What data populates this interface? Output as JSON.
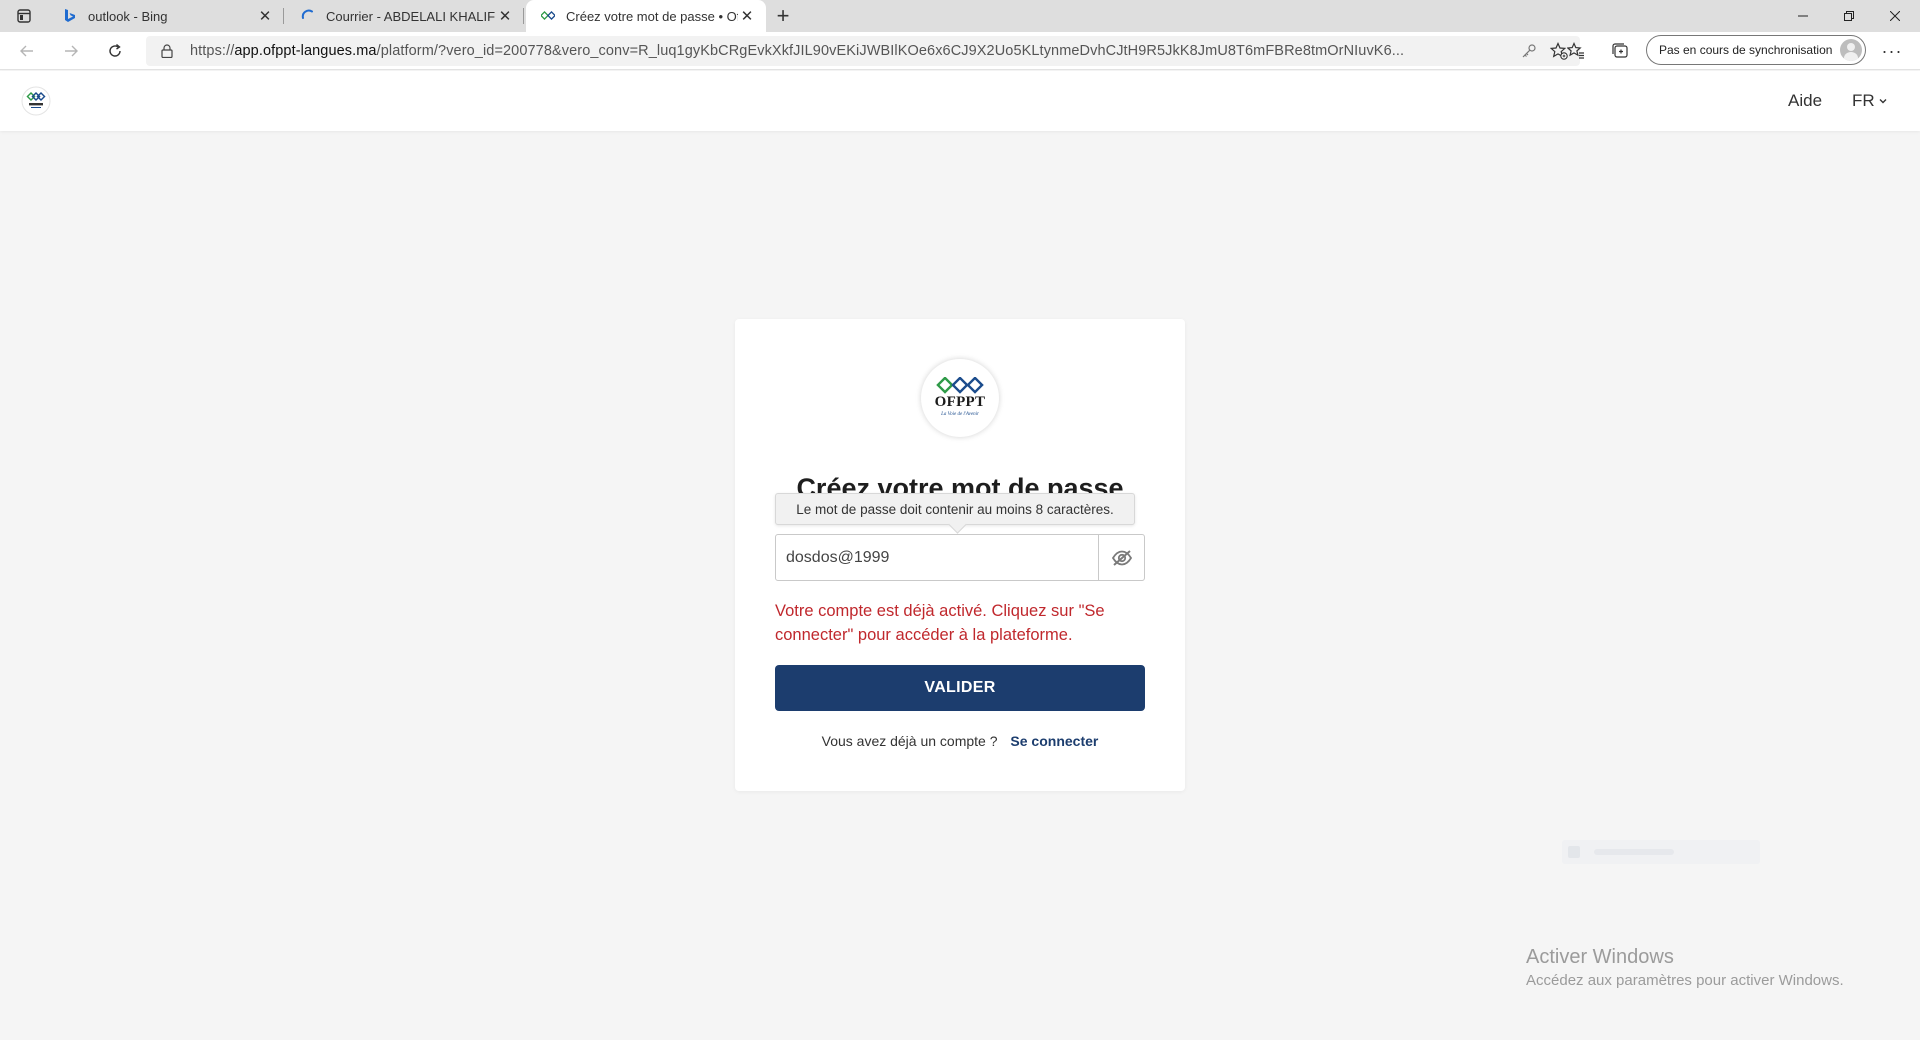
{
  "browser": {
    "tabs": [
      {
        "title": "outlook - Bing",
        "favicon": "bing-icon",
        "active": false
      },
      {
        "title": "Courrier - ABDELALI KHALIF - Ou",
        "favicon": "outlook-loading-icon",
        "active": false
      },
      {
        "title": "Créez votre mot de passe • Ofpp",
        "favicon": "ofppt-icon",
        "active": true
      }
    ],
    "url": {
      "prefix": "https://",
      "host": "app.ofppt-langues.ma",
      "path": "/platform/?vero_id=200778&vero_conv=R_luq1gyKbCRgEvkXkfJIL90vEKiJWBIlKOe6x6CJ9X2Uo5KLtynmeDvhCJtH9R5JkK8JmU8T6mFBRe8tmOrNIuvK6..."
    },
    "sync_label": "Pas en cours de synchronisation",
    "colors": {
      "tabbar": "#dedede",
      "active_tab": "#ffffff"
    }
  },
  "site": {
    "help_label": "Aide",
    "lang_label": "FR"
  },
  "card": {
    "logo_text": "OFPPT",
    "logo_tagline": "La Voie de l'Avenir",
    "title": "Créez votre mot de passe",
    "tooltip": "Le mot de passe doit contenir au moins 8 caractères.",
    "password_value": "dosdos@1999",
    "error": "Votre compte est déjà activé. Cliquez sur \"Se connecter\" pour accéder à la plateforme.",
    "submit_label": "VALIDER",
    "login_prompt": "Vous avez déjà un compte ?",
    "login_link": "Se connecter",
    "colors": {
      "primary": "#1c3d6e",
      "error": "#c0282d",
      "logo_green": "#2e9a47",
      "logo_blue": "#1a4b8c"
    }
  },
  "watermark": {
    "title": "Activer Windows",
    "subtitle": "Accédez aux paramètres pour activer Windows."
  }
}
